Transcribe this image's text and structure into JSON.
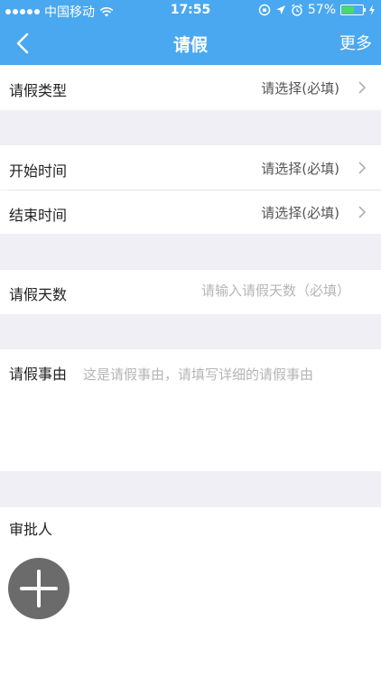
{
  "status_bar": {
    "carrier": "中国移动",
    "time": "17:55",
    "battery": "57%",
    "battery_level": 0.57
  },
  "nav": {
    "title": "请假",
    "more_label": "更多",
    "back_icon": "chevron-left-icon"
  },
  "form": {
    "leave_type": {
      "label": "请假类型",
      "value": "请选择(必填)"
    },
    "start_time": {
      "label": "开始时间",
      "value": "请选择(必填)"
    },
    "end_time": {
      "label": "结束时间",
      "value": "请选择(必填)"
    },
    "leave_days": {
      "label": "请假天数",
      "placeholder": "请输入请假天数（必填）",
      "value": ""
    },
    "reason": {
      "label": "请假事由",
      "placeholder": "这是请假事由，请填写详细的请假事由",
      "value": ""
    },
    "approver": {
      "label": "审批人",
      "add_icon": "plus-icon"
    }
  },
  "colors": {
    "header": "#4aa8f0",
    "background": "#f0eff5",
    "add_button": "#6b6b6b",
    "battery": "#4cd964"
  }
}
